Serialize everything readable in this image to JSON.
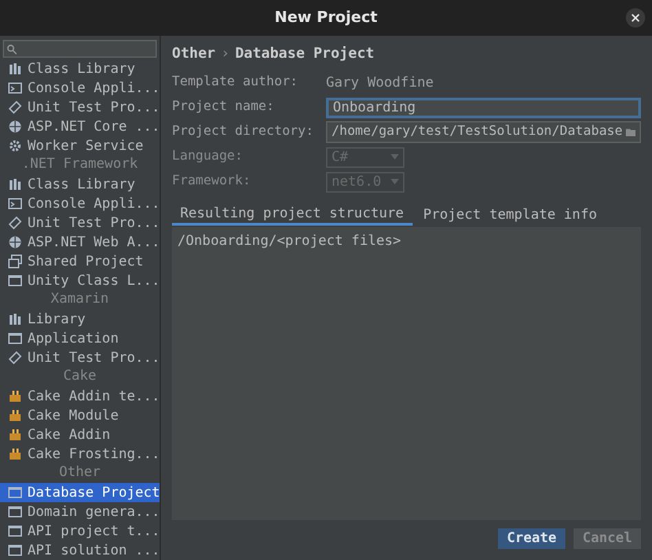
{
  "window": {
    "title": "New Project"
  },
  "sidebar": {
    "items": [
      {
        "kind": "item",
        "label": "Class Library",
        "selected": false
      },
      {
        "kind": "item",
        "label": "Console Appli...",
        "selected": false
      },
      {
        "kind": "item",
        "label": "Unit Test Pro...",
        "selected": false
      },
      {
        "kind": "item",
        "label": "ASP.NET Core ...",
        "selected": false
      },
      {
        "kind": "item",
        "label": "Worker Service",
        "selected": false
      },
      {
        "kind": "header",
        "label": ".NET Framework"
      },
      {
        "kind": "item",
        "label": "Class Library",
        "selected": false
      },
      {
        "kind": "item",
        "label": "Console Appli...",
        "selected": false
      },
      {
        "kind": "item",
        "label": "Unit Test Pro...",
        "selected": false
      },
      {
        "kind": "item",
        "label": "ASP.NET Web A...",
        "selected": false
      },
      {
        "kind": "item",
        "label": "Shared Project",
        "selected": false
      },
      {
        "kind": "item",
        "label": "Unity Class L...",
        "selected": false
      },
      {
        "kind": "header",
        "label": "Xamarin"
      },
      {
        "kind": "item",
        "label": "Library",
        "selected": false
      },
      {
        "kind": "item",
        "label": "Application",
        "selected": false
      },
      {
        "kind": "item",
        "label": "Unit Test Pro...",
        "selected": false
      },
      {
        "kind": "header",
        "label": "Cake"
      },
      {
        "kind": "item",
        "label": "Cake Addin te...",
        "selected": false
      },
      {
        "kind": "item",
        "label": "Cake Module",
        "selected": false
      },
      {
        "kind": "item",
        "label": "Cake Addin",
        "selected": false
      },
      {
        "kind": "item",
        "label": "Cake Frosting...",
        "selected": false
      },
      {
        "kind": "header",
        "label": "Other"
      },
      {
        "kind": "item",
        "label": "Database Project",
        "selected": true
      },
      {
        "kind": "item",
        "label": "Domain genera...",
        "selected": false
      },
      {
        "kind": "item",
        "label": "API project t...",
        "selected": false
      },
      {
        "kind": "item",
        "label": "API solution ...",
        "selected": false
      }
    ]
  },
  "breadcrumb": [
    "Other",
    "›",
    "Database Project"
  ],
  "form": [
    {
      "kind": "text",
      "label": "Template author:",
      "value": "Gary Woodfine"
    },
    {
      "kind": "input",
      "label": "Project name:",
      "value": "Onboarding",
      "focused": true
    },
    {
      "kind": "path",
      "label": "Project directory:",
      "value": "/home/gary/test/TestSolution/Database"
    },
    {
      "kind": "dropdown",
      "label": "Language:",
      "value": "C#",
      "disabled": true
    },
    {
      "kind": "dropdown",
      "label": "Framework:",
      "value": "net6.0",
      "disabled": true
    }
  ],
  "tabs": [
    {
      "label": "Resulting project structure",
      "selected": true
    },
    {
      "label": "Project template info",
      "selected": false
    }
  ],
  "structure": "/Onboarding/<project files>",
  "buttons": [
    {
      "label": "Create",
      "kind": "primary"
    },
    {
      "label": "Cancel",
      "kind": "secondary"
    }
  ]
}
